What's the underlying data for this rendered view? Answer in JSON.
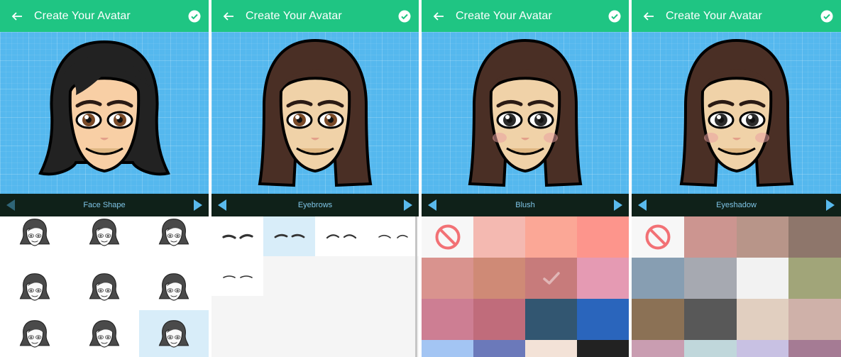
{
  "app": {
    "title": "Create Your Avatar",
    "back_icon": "arrow-left-icon",
    "done_icon": "check-circle-icon",
    "header_color": "#1fc583",
    "canvas_color": "#55b8ee",
    "category_bar_color": "#0f2119",
    "selected_cell_color": "#d8edf9"
  },
  "screens": [
    {
      "category": "Face Shape",
      "prev_enabled": false,
      "avatar": {
        "hair": "#222222",
        "hair_style": "short",
        "skin": "#f8cfa5",
        "iris": "#7a4a28",
        "blush": false
      },
      "face_options": {
        "count": 9,
        "selected_index": 8
      }
    },
    {
      "category": "Eyebrows",
      "prev_enabled": true,
      "avatar": {
        "hair": "#4a2f25",
        "hair_style": "long",
        "skin": "#f0d2a8",
        "iris": "#7a4a28",
        "blush": false
      },
      "eyebrow_options": {
        "count": 5,
        "selected_index": 1
      }
    },
    {
      "category": "Blush",
      "prev_enabled": true,
      "avatar": {
        "hair": "#4a2f25",
        "hair_style": "long",
        "skin": "#f0d2a8",
        "iris": "#2b2b2b",
        "blush": true
      },
      "swatches": {
        "none_icon": "no-entry-icon",
        "selected_index": 6,
        "selected_icon": "checkmark-icon",
        "colors": [
          "none",
          "#f4b9b1",
          "#fba796",
          "#fd958c",
          "#d9938e",
          "#cf8a76",
          "#c77b7b",
          "#e59ab3",
          "#cd7e93",
          "#c06c7b",
          "#325671",
          "#2a65bc",
          "#a3c5f3",
          "#6b79ba",
          "#f3e2d7",
          "#222222"
        ]
      }
    },
    {
      "category": "Eyeshadow",
      "prev_enabled": true,
      "avatar": {
        "hair": "#4a2f25",
        "hair_style": "long",
        "skin": "#f0d2a8",
        "iris": "#2b2b2b",
        "blush": true
      },
      "swatches": {
        "none_icon": "no-entry-icon",
        "selected_index": -1,
        "colors": [
          "none",
          "#cc9590",
          "#b89589",
          "#8e766b",
          "#879eb2",
          "#a6a9b1",
          "#f2f2f2",
          "#a1a579",
          "#8b7155",
          "#585858",
          "#e1cfc0",
          "#cfb1a9",
          "#c99db1",
          "#c0d7db",
          "#c8c1e3",
          "#a57b94"
        ]
      }
    }
  ]
}
